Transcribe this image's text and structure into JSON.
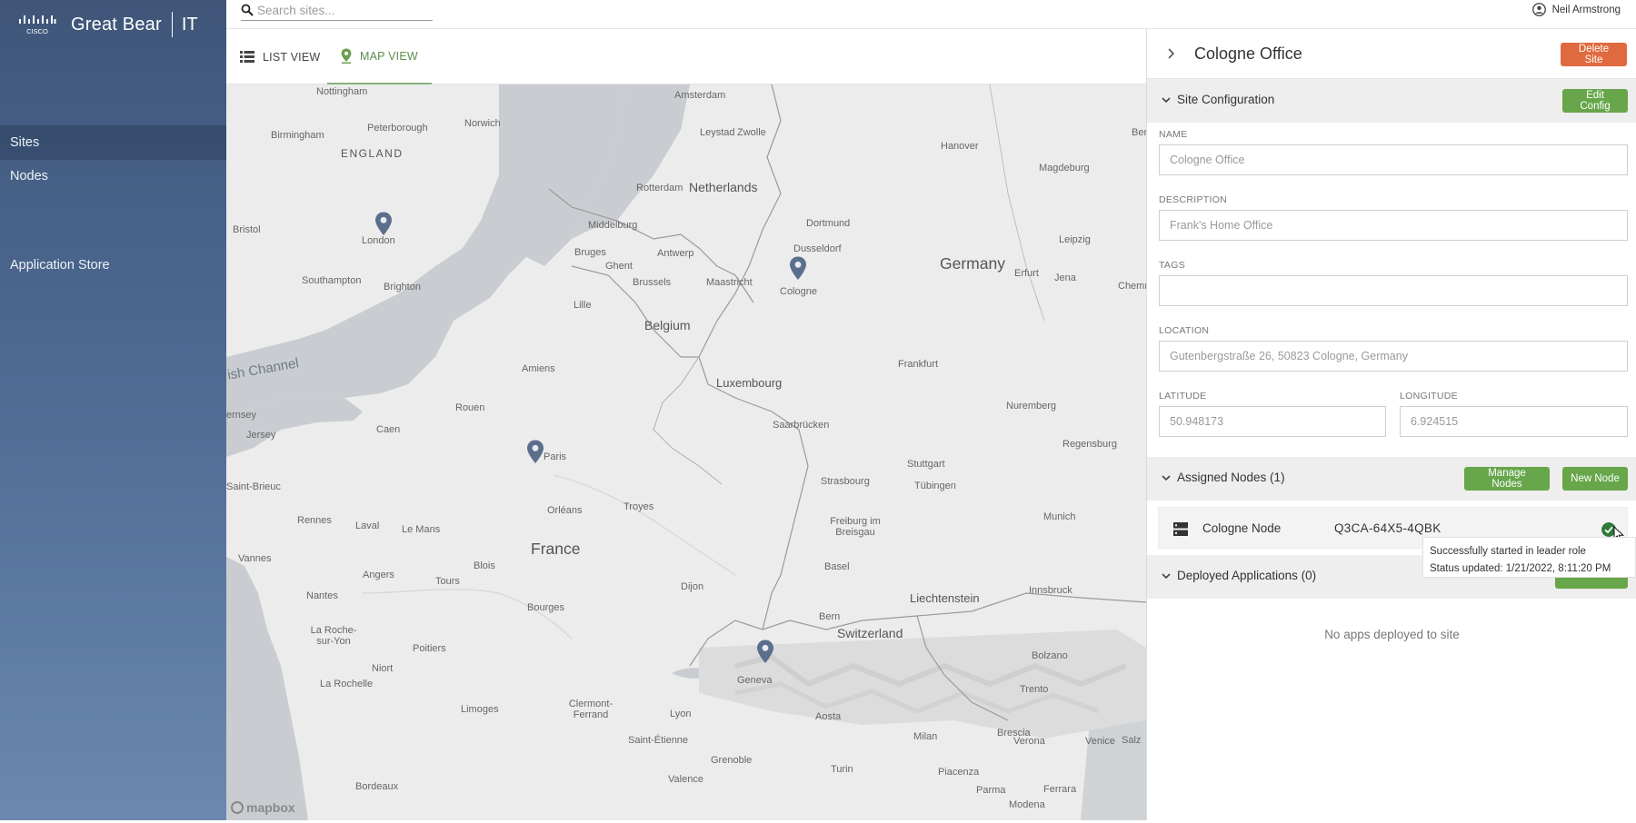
{
  "brand": {
    "vendor_logo": "cisco-logo",
    "name": "Great Bear",
    "suffix": "IT"
  },
  "sidebar": {
    "items": [
      {
        "label": "Sites",
        "active": true
      },
      {
        "label": "Nodes",
        "active": false
      },
      {
        "label": "Application Store",
        "active": false
      }
    ]
  },
  "topbar": {
    "search_placeholder": "Search sites...",
    "user_name": "Neil Armstrong",
    "search_icon": "search-icon",
    "user_icon": "user-circle-icon"
  },
  "tabs": [
    {
      "label": "LIST VIEW",
      "icon": "list-icon",
      "active": false
    },
    {
      "label": "MAP VIEW",
      "icon": "map-pin-icon",
      "active": true
    }
  ],
  "map": {
    "countries": [
      "Netherlands",
      "Germany",
      "Belgium",
      "Luxembourg",
      "France",
      "Switzerland",
      "Liechtenstein",
      "ENGLAND"
    ],
    "places": [
      "Nottingham",
      "Birmingham",
      "Peterborough",
      "Norwich",
      "Bristol",
      "London",
      "Southampton",
      "Brighton",
      "Rotterdam",
      "Middelburg",
      "Bruges",
      "Antwerp",
      "Ghent",
      "Brussels",
      "Lille",
      "Maastricht",
      "Dortmund",
      "Dusseldorf",
      "Cologne",
      "Hanover",
      "Magdeburg",
      "Leipzig",
      "Erfurt",
      "Jena",
      "Chemn",
      "Frankfurt",
      "Nuremberg",
      "Regensburg",
      "Amiens",
      "Rouen",
      "Caen",
      "Paris",
      "Jersey",
      "ernsey",
      "Saint-Brieuc",
      "Rennes",
      "Laval",
      "Le Mans",
      "Vannes",
      "Nantes",
      "Angers",
      "Tours",
      "Blois",
      "Troyes",
      "Orléans",
      "La Roche-sur-Yon",
      "Niort",
      "Poitiers",
      "La Rochelle",
      "Limoges",
      "Bourges",
      "Dijon",
      "Clermont-Ferrand",
      "Lyon",
      "Saint-Étienne",
      "Valence",
      "Grenoble",
      "Geneva",
      "Bern",
      "Basel",
      "Freiburg im Breisgau",
      "Strasbourg",
      "Saarbrücken",
      "Stuttgart",
      "Tübingen",
      "Munich",
      "Innsbruck",
      "Bolzano",
      "Trento",
      "Aosta",
      "Milan",
      "Turin",
      "Brescia",
      "Verona",
      "Venice",
      "Piacenza",
      "Parma",
      "Modena",
      "Ferrara",
      "Salz",
      "Bordeaux",
      "Amsterdam",
      "Leystad",
      "Zwolle",
      "Ber"
    ],
    "channel_label": "ish Channel",
    "attribution": "mapbox",
    "markers": [
      "london-site-marker",
      "cologne-site-marker",
      "paris-site-marker",
      "geneva-site-marker"
    ]
  },
  "panel": {
    "title": "Cologne Office",
    "delete_label": "Delete Site",
    "config": {
      "title": "Site Configuration",
      "edit_label": "Edit Config",
      "fields": {
        "name_label": "NAME",
        "name_value": "Cologne Office",
        "description_label": "DESCRIPTION",
        "description_value": "Frank's Home Office",
        "tags_label": "TAGS",
        "tags_value": "",
        "location_label": "LOCATION",
        "location_value": "Gutenbergstraße 26, 50823 Cologne, Germany",
        "latitude_label": "LATITUDE",
        "latitude_value": "50.948173",
        "longitude_label": "LONGITUDE",
        "longitude_value": "6.924515"
      }
    },
    "nodes": {
      "title": "Assigned Nodes (1)",
      "manage_label": "Manage Nodes",
      "new_label": "New Node",
      "items": [
        {
          "name": "Cologne Node",
          "id": "Q3CA-64X5-4QBK",
          "status_icon": "check-circle-icon",
          "status_color": "#2e7a3a"
        }
      ]
    },
    "apps": {
      "title": "Deployed Applications (0)",
      "empty_text": "No apps deployed to site"
    },
    "tooltip": {
      "line1": "Successfully started in leader role",
      "line2": "Status updated: 1/21/2022, 8:11:20 PM"
    }
  },
  "colors": {
    "accent_green": "#67a64a",
    "danger_orange": "#e06a3f",
    "sidebar": "#4c6790",
    "marker": "#5b6f8c"
  }
}
